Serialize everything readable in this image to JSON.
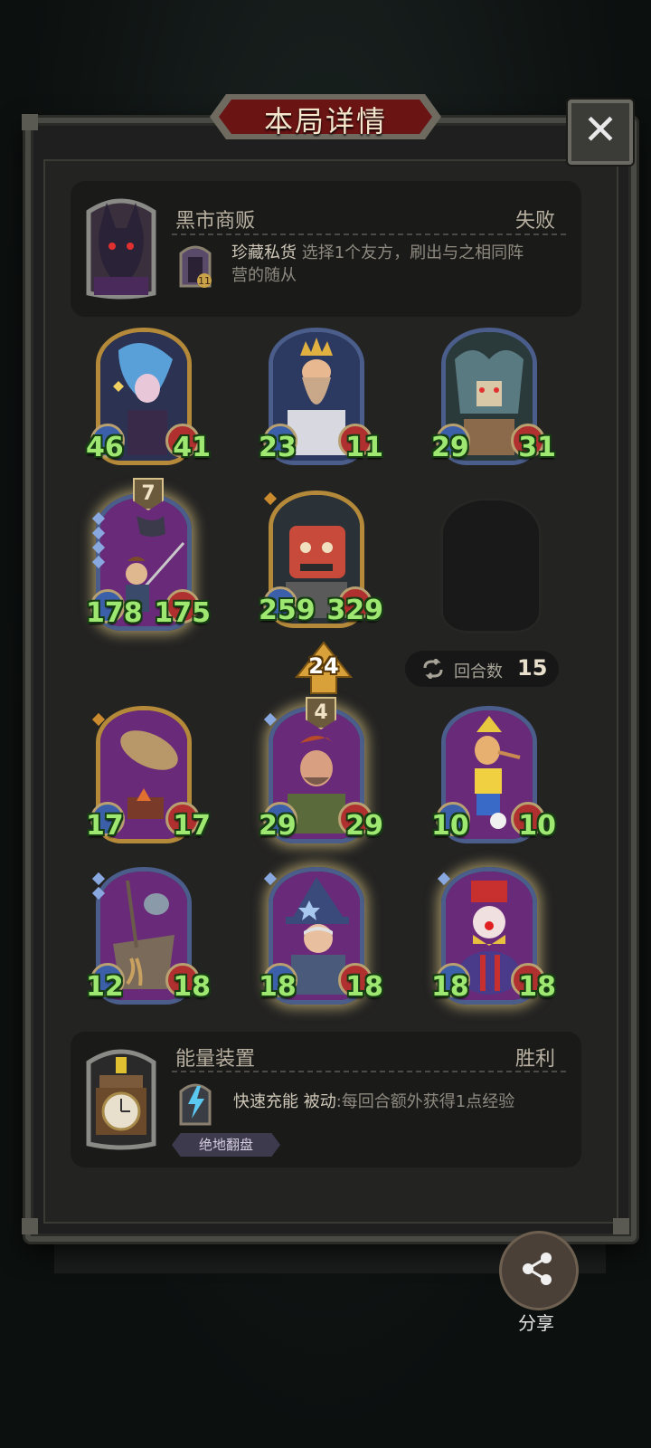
{
  "header": {
    "title": "本局详情"
  },
  "close_button": {
    "icon": "close-icon"
  },
  "opponent": {
    "name": "黑市商贩",
    "result": "失败",
    "item_name": "珍藏私货",
    "item_desc_line1": "选择1个友方，刷出与之相同阵",
    "item_desc_line2": "营的随从"
  },
  "board_top": [
    {
      "atk": "46",
      "hp": "41"
    },
    {
      "atk": "23",
      "hp": "11"
    },
    {
      "atk": "29",
      "hp": "31"
    },
    {
      "atk": "178",
      "hp": "175",
      "level": "7"
    },
    {
      "atk": "259",
      "hp": "329"
    }
  ],
  "turn_info": {
    "arrow_value": "24",
    "round_label": "回合数",
    "round_value": "15"
  },
  "board_bottom": [
    {
      "atk": "17",
      "hp": "17"
    },
    {
      "atk": "29",
      "hp": "29",
      "level": "4"
    },
    {
      "atk": "10",
      "hp": "10"
    },
    {
      "atk": "12",
      "hp": "18"
    },
    {
      "atk": "18",
      "hp": "18"
    },
    {
      "atk": "18",
      "hp": "18"
    }
  ],
  "player": {
    "name": "能量装置",
    "result": "胜利",
    "item_name": "快速充能",
    "item_type": "被动",
    "item_desc": ":每回合额外获得1点经验",
    "tag": "绝地翻盘"
  },
  "share": {
    "label": "分享"
  },
  "colors": {
    "stat_green": "#9ee872",
    "gold_frame": "#b48a3a",
    "silver_frame": "#4b5d8a"
  }
}
